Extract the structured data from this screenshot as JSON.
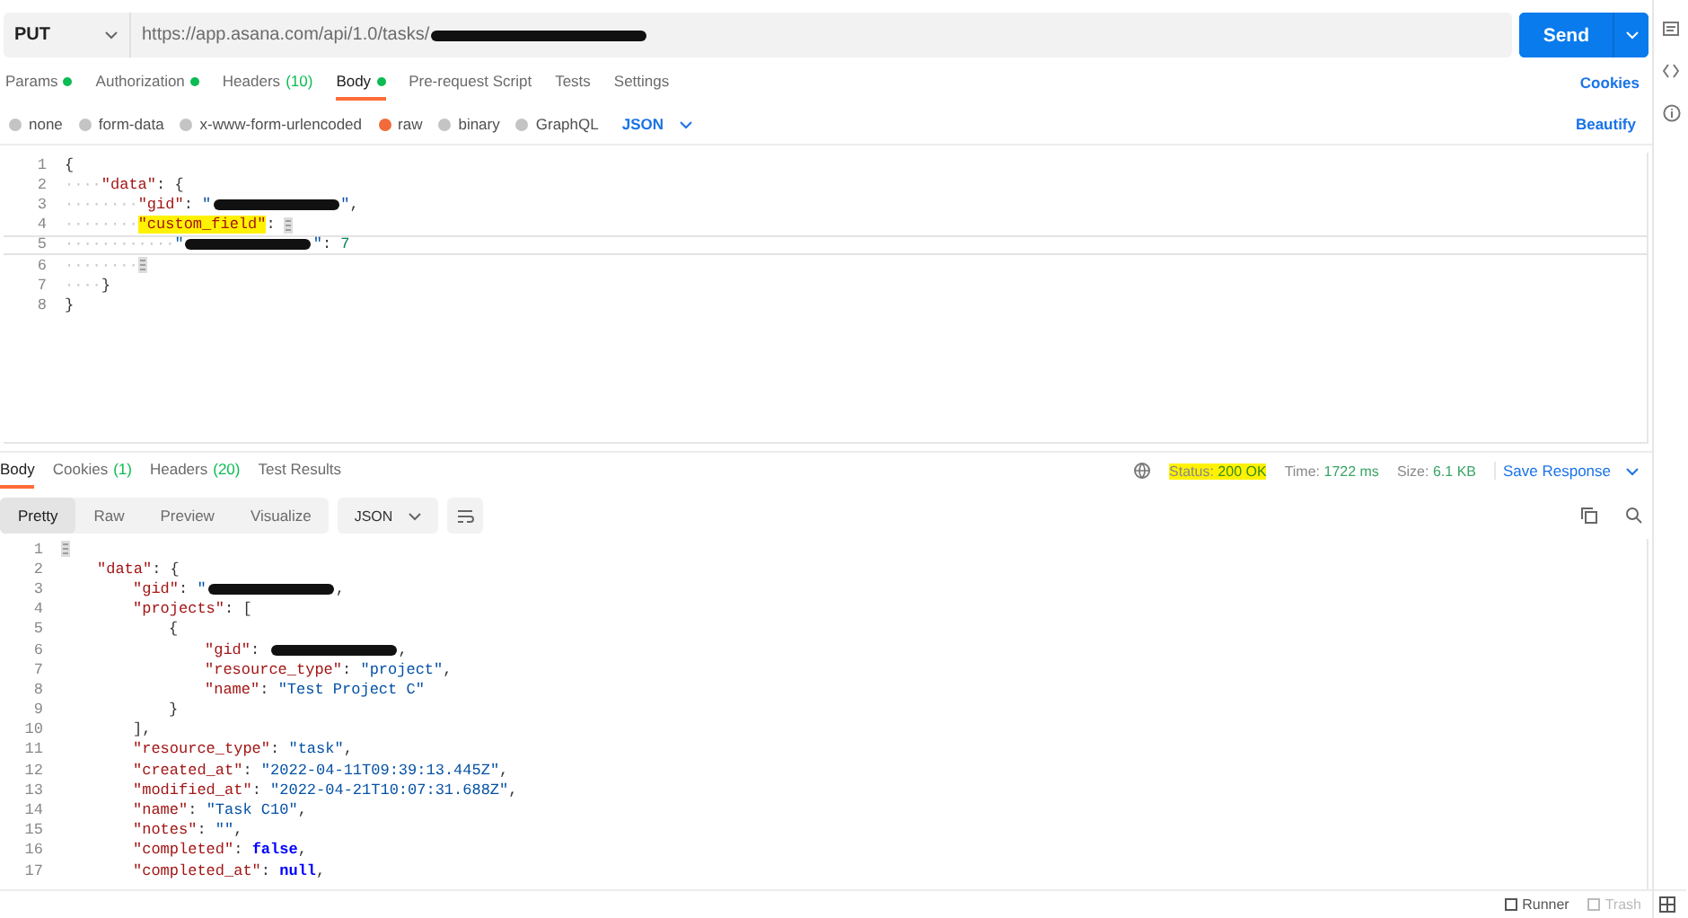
{
  "request": {
    "method": "PUT",
    "url": "https://app.asana.com/api/1.0/tasks/",
    "url_redacted": true,
    "send": "Send"
  },
  "request_tabs": [
    {
      "label": "Params",
      "dot": true,
      "selected": false
    },
    {
      "label": "Authorization",
      "dot": true,
      "selected": false
    },
    {
      "label": "Headers",
      "count": "(10)",
      "dot": false,
      "selected": false
    },
    {
      "label": "Body",
      "dot": true,
      "selected": true
    },
    {
      "label": "Pre-request Script",
      "dot": false,
      "selected": false
    },
    {
      "label": "Tests",
      "dot": false,
      "selected": false
    },
    {
      "label": "Settings",
      "dot": false,
      "selected": false
    }
  ],
  "cookies_link": "Cookies",
  "body_types": [
    {
      "label": "none",
      "selected": false
    },
    {
      "label": "form-data",
      "selected": false
    },
    {
      "label": "x-www-form-urlencoded",
      "selected": false
    },
    {
      "label": "raw",
      "selected": true
    },
    {
      "label": "binary",
      "selected": false
    },
    {
      "label": "GraphQL",
      "selected": false
    }
  ],
  "body_format": "JSON",
  "beautify": "Beautify",
  "request_body": [
    {
      "number": "1",
      "active": false,
      "tokens": [
        {
          "kind": "punct",
          "text": "{"
        }
      ]
    },
    {
      "number": "2",
      "active": false,
      "tokens": [
        {
          "kind": "ws",
          "text": "····"
        },
        {
          "kind": "key",
          "text": "\"data\""
        },
        {
          "kind": "punct",
          "text": ": {"
        }
      ]
    },
    {
      "number": "3",
      "active": false,
      "tokens": [
        {
          "kind": "ws",
          "text": "········"
        },
        {
          "kind": "key",
          "text": "\"gid\""
        },
        {
          "kind": "punct",
          "text": ": "
        },
        {
          "kind": "string",
          "text": "\""
        },
        {
          "kind": "redacted"
        },
        {
          "kind": "string",
          "text": "\""
        },
        {
          "kind": "punct",
          "text": ","
        }
      ]
    },
    {
      "number": "4",
      "active": false,
      "tokens": [
        {
          "kind": "ws",
          "text": "········"
        },
        {
          "kind": "key",
          "text": "\"custom_field\"",
          "highlighted": true
        },
        {
          "kind": "punct",
          "text": ": "
        },
        {
          "kind": "fold"
        }
      ]
    },
    {
      "number": "5",
      "active": true,
      "tokens": [
        {
          "kind": "ws",
          "text": "············"
        },
        {
          "kind": "string",
          "text": "\""
        },
        {
          "kind": "redacted"
        },
        {
          "kind": "string",
          "text": "\""
        },
        {
          "kind": "punct",
          "text": ": "
        },
        {
          "kind": "number",
          "text": "7"
        }
      ]
    },
    {
      "number": "6",
      "active": false,
      "tokens": [
        {
          "kind": "ws",
          "text": "········"
        },
        {
          "kind": "fold"
        }
      ]
    },
    {
      "number": "7",
      "active": false,
      "tokens": [
        {
          "kind": "ws",
          "text": "····"
        },
        {
          "kind": "punct",
          "text": "}"
        }
      ]
    },
    {
      "number": "8",
      "active": false,
      "tokens": [
        {
          "kind": "punct",
          "text": "}"
        }
      ]
    }
  ],
  "response_tabs": [
    {
      "label": "Body",
      "selected": true
    },
    {
      "label": "Cookies",
      "count": "(1)",
      "selected": false
    },
    {
      "label": "Headers",
      "count": "(20)",
      "selected": false
    },
    {
      "label": "Test Results",
      "selected": false
    }
  ],
  "response_meta": {
    "status_label": "Status:",
    "status": "200 OK",
    "status_highlighted": true,
    "time_label": "Time:",
    "time": "1722 ms",
    "size_label": "Size:",
    "size": "6.1 KB",
    "save": "Save Response"
  },
  "view_modes": [
    {
      "label": "Pretty",
      "selected": true
    },
    {
      "label": "Raw",
      "selected": false
    },
    {
      "label": "Preview",
      "selected": false
    },
    {
      "label": "Visualize",
      "selected": false
    }
  ],
  "response_format": "JSON",
  "response_body": [
    {
      "number": "1",
      "tokens": [
        {
          "kind": "fold"
        }
      ]
    },
    {
      "number": "2",
      "tokens": [
        {
          "kind": "indent"
        },
        {
          "kind": "key",
          "text": "\"data\""
        },
        {
          "kind": "punct",
          "text": ": {"
        }
      ]
    },
    {
      "number": "3",
      "tokens": [
        {
          "kind": "indent"
        },
        {
          "kind": "indent"
        },
        {
          "kind": "key",
          "text": "\"gid\""
        },
        {
          "kind": "punct",
          "text": ": "
        },
        {
          "kind": "string",
          "text": "\""
        },
        {
          "kind": "redacted"
        },
        {
          "kind": "punct",
          "text": ","
        }
      ]
    },
    {
      "number": "4",
      "tokens": [
        {
          "kind": "indent"
        },
        {
          "kind": "indent"
        },
        {
          "kind": "key",
          "text": "\"projects\""
        },
        {
          "kind": "punct",
          "text": ": ["
        }
      ]
    },
    {
      "number": "5",
      "tokens": [
        {
          "kind": "indent"
        },
        {
          "kind": "indent"
        },
        {
          "kind": "indent"
        },
        {
          "kind": "punct",
          "text": "{"
        }
      ]
    },
    {
      "number": "6",
      "tokens": [
        {
          "kind": "indent"
        },
        {
          "kind": "indent"
        },
        {
          "kind": "indent"
        },
        {
          "kind": "indent"
        },
        {
          "kind": "key",
          "text": "\"gid\""
        },
        {
          "kind": "punct",
          "text": ": "
        },
        {
          "kind": "redacted"
        },
        {
          "kind": "punct",
          "text": ","
        }
      ]
    },
    {
      "number": "7",
      "tokens": [
        {
          "kind": "indent"
        },
        {
          "kind": "indent"
        },
        {
          "kind": "indent"
        },
        {
          "kind": "indent"
        },
        {
          "kind": "key",
          "text": "\"resource_type\""
        },
        {
          "kind": "punct",
          "text": ": "
        },
        {
          "kind": "string",
          "text": "\"project\""
        },
        {
          "kind": "punct",
          "text": ","
        }
      ]
    },
    {
      "number": "8",
      "tokens": [
        {
          "kind": "indent"
        },
        {
          "kind": "indent"
        },
        {
          "kind": "indent"
        },
        {
          "kind": "indent"
        },
        {
          "kind": "key",
          "text": "\"name\""
        },
        {
          "kind": "punct",
          "text": ": "
        },
        {
          "kind": "string",
          "text": "\"Test Project C\""
        }
      ]
    },
    {
      "number": "9",
      "tokens": [
        {
          "kind": "indent"
        },
        {
          "kind": "indent"
        },
        {
          "kind": "indent"
        },
        {
          "kind": "punct",
          "text": "}"
        }
      ]
    },
    {
      "number": "10",
      "tokens": [
        {
          "kind": "indent"
        },
        {
          "kind": "indent"
        },
        {
          "kind": "punct",
          "text": "],"
        }
      ]
    },
    {
      "number": "11",
      "tokens": [
        {
          "kind": "indent"
        },
        {
          "kind": "indent"
        },
        {
          "kind": "key",
          "text": "\"resource_type\""
        },
        {
          "kind": "punct",
          "text": ": "
        },
        {
          "kind": "string",
          "text": "\"task\""
        },
        {
          "kind": "punct",
          "text": ","
        }
      ]
    },
    {
      "number": "12",
      "tokens": [
        {
          "kind": "indent"
        },
        {
          "kind": "indent"
        },
        {
          "kind": "key",
          "text": "\"created_at\""
        },
        {
          "kind": "punct",
          "text": ": "
        },
        {
          "kind": "string",
          "text": "\"2022-04-11T09:39:13.445Z\""
        },
        {
          "kind": "punct",
          "text": ","
        }
      ]
    },
    {
      "number": "13",
      "tokens": [
        {
          "kind": "indent"
        },
        {
          "kind": "indent"
        },
        {
          "kind": "key",
          "text": "\"modified_at\""
        },
        {
          "kind": "punct",
          "text": ": "
        },
        {
          "kind": "string",
          "text": "\"2022-04-21T10:07:31.688Z\""
        },
        {
          "kind": "punct",
          "text": ","
        }
      ]
    },
    {
      "number": "14",
      "tokens": [
        {
          "kind": "indent"
        },
        {
          "kind": "indent"
        },
        {
          "kind": "key",
          "text": "\"name\""
        },
        {
          "kind": "punct",
          "text": ": "
        },
        {
          "kind": "string",
          "text": "\"Task C10\""
        },
        {
          "kind": "punct",
          "text": ","
        }
      ]
    },
    {
      "number": "15",
      "tokens": [
        {
          "kind": "indent"
        },
        {
          "kind": "indent"
        },
        {
          "kind": "key",
          "text": "\"notes\""
        },
        {
          "kind": "punct",
          "text": ": "
        },
        {
          "kind": "string",
          "text": "\"\""
        },
        {
          "kind": "punct",
          "text": ","
        }
      ]
    },
    {
      "number": "16",
      "tokens": [
        {
          "kind": "indent"
        },
        {
          "kind": "indent"
        },
        {
          "kind": "key",
          "text": "\"completed\""
        },
        {
          "kind": "punct",
          "text": ": "
        },
        {
          "kind": "literal",
          "text": "false"
        },
        {
          "kind": "punct",
          "text": ","
        }
      ]
    },
    {
      "number": "17",
      "tokens": [
        {
          "kind": "indent"
        },
        {
          "kind": "indent"
        },
        {
          "kind": "key",
          "text": "\"completed_at\""
        },
        {
          "kind": "punct",
          "text": ": "
        },
        {
          "kind": "literal",
          "text": "null"
        },
        {
          "kind": "punct",
          "text": ","
        }
      ]
    }
  ],
  "footer": [
    {
      "label": "Runner",
      "disabled": false
    },
    {
      "label": "Trash",
      "disabled": true
    }
  ]
}
